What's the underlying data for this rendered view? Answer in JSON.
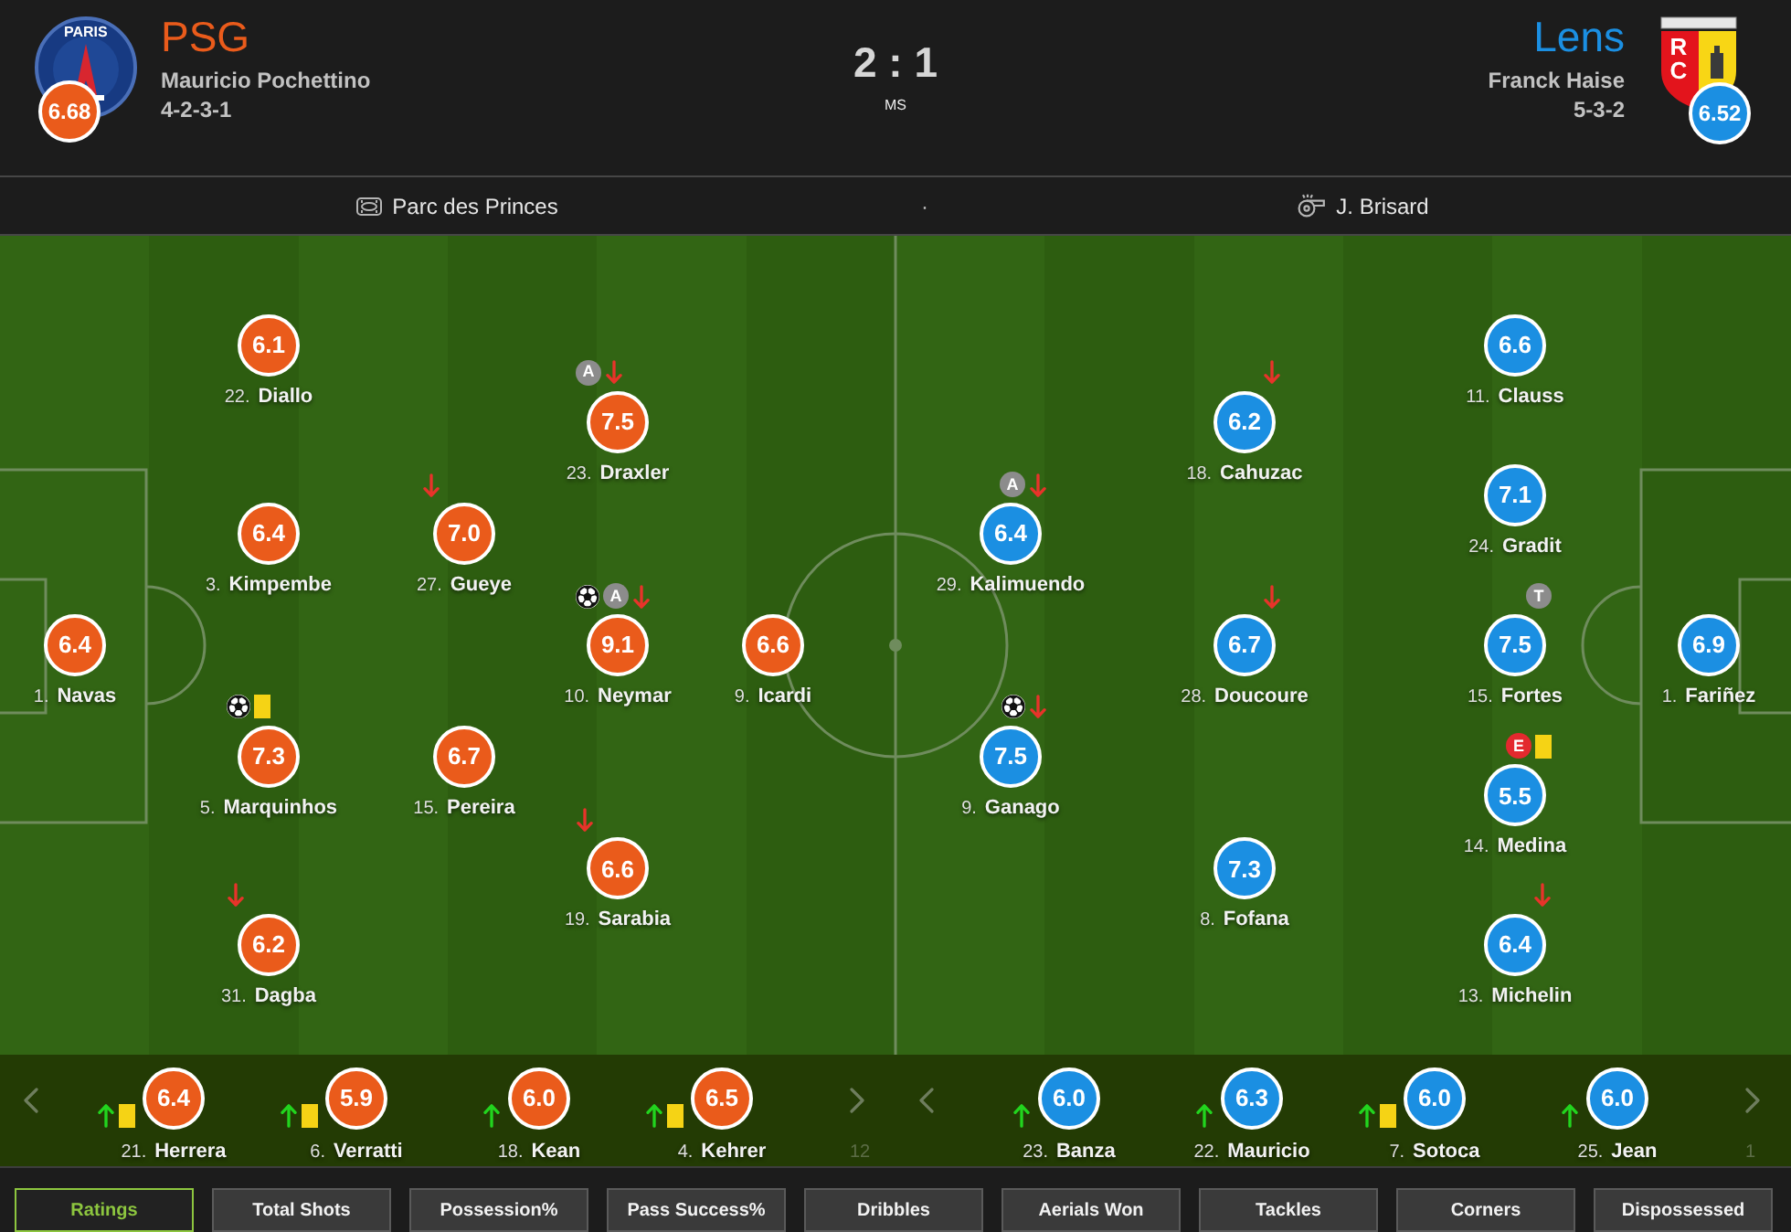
{
  "header": {
    "teams": [
      {
        "name": "PSG",
        "manager": "Mauricio Pochettino",
        "formation": "4-2-3-1",
        "rating": "6.68",
        "color": "#ea5b1b",
        "crest": {
          "kind": "roundel",
          "text": "PARIS"
        }
      },
      {
        "name": "Lens",
        "manager": "Franck Haise",
        "formation": "5-3-2",
        "rating": "6.52",
        "color": "#1b8fe2",
        "crest": {
          "kind": "shield",
          "text": "RC"
        }
      }
    ],
    "score": "2 : 1",
    "status": "MS"
  },
  "info_bar": {
    "venue": "Parc des Princes",
    "separator": "·",
    "referee": "J. Brisard"
  },
  "pitch": {
    "teams": [
      {
        "color": "#ea5b1b",
        "lines": [
          {
            "players": [
              {
                "number": "1.",
                "name": "Navas",
                "rating": "6.4"
              }
            ]
          },
          {
            "players": [
              {
                "number": "22.",
                "name": "Diallo",
                "rating": "6.1"
              },
              {
                "number": "3.",
                "name": "Kimpembe",
                "rating": "6.4"
              },
              {
                "number": "5.",
                "name": "Marquinhos",
                "rating": "7.3",
                "events": [
                  {
                    "kind": "goal"
                  },
                  {
                    "kind": "yellow_card"
                  }
                ]
              },
              {
                "number": "31.",
                "name": "Dagba",
                "rating": "6.2",
                "events": [
                  {
                    "kind": "subbed_off"
                  }
                ]
              }
            ]
          },
          {
            "players": [
              {
                "number": "27.",
                "name": "Gueye",
                "rating": "7.0",
                "events": [
                  {
                    "kind": "subbed_off"
                  }
                ]
              },
              {
                "number": "15.",
                "name": "Pereira",
                "rating": "6.7"
              }
            ]
          },
          {
            "players": [
              {
                "number": "23.",
                "name": "Draxler",
                "rating": "7.5",
                "events": [
                  {
                    "kind": "badge",
                    "text": "A",
                    "color": "#8c8c8c"
                  },
                  {
                    "kind": "subbed_off"
                  }
                ]
              },
              {
                "number": "10.",
                "name": "Neymar",
                "rating": "9.1",
                "events": [
                  {
                    "kind": "goal"
                  },
                  {
                    "kind": "badge",
                    "text": "A",
                    "color": "#8c8c8c"
                  },
                  {
                    "kind": "subbed_off"
                  }
                ]
              },
              {
                "number": "19.",
                "name": "Sarabia",
                "rating": "6.6",
                "events": [
                  {
                    "kind": "subbed_off"
                  }
                ]
              }
            ]
          },
          {
            "players": [
              {
                "number": "9.",
                "name": "Icardi",
                "rating": "6.6"
              }
            ]
          }
        ]
      },
      {
        "color": "#1b8fe2",
        "lines": [
          {
            "players": [
              {
                "number": "29.",
                "name": "Kalimuendo",
                "rating": "6.4",
                "events": [
                  {
                    "kind": "badge",
                    "text": "A",
                    "color": "#8c8c8c"
                  },
                  {
                    "kind": "subbed_off"
                  }
                ]
              },
              {
                "number": "9.",
                "name": "Ganago",
                "rating": "7.5",
                "events": [
                  {
                    "kind": "goal"
                  },
                  {
                    "kind": "subbed_off"
                  }
                ]
              }
            ]
          },
          {
            "players": [
              {
                "number": "18.",
                "name": "Cahuzac",
                "rating": "6.2",
                "events": [
                  {
                    "kind": "subbed_off"
                  }
                ]
              },
              {
                "number": "28.",
                "name": "Doucoure",
                "rating": "6.7",
                "events": [
                  {
                    "kind": "subbed_off"
                  }
                ]
              },
              {
                "number": "8.",
                "name": "Fofana",
                "rating": "7.3"
              }
            ]
          },
          {
            "players": [
              {
                "number": "11.",
                "name": "Clauss",
                "rating": "6.6"
              },
              {
                "number": "24.",
                "name": "Gradit",
                "rating": "7.1"
              },
              {
                "number": "15.",
                "name": "Fortes",
                "rating": "7.5",
                "events": [
                  {
                    "kind": "badge",
                    "text": "T",
                    "color": "#8c8c8c"
                  }
                ]
              },
              {
                "number": "14.",
                "name": "Medina",
                "rating": "5.5",
                "events": [
                  {
                    "kind": "badge",
                    "text": "E",
                    "color": "#e3292e"
                  },
                  {
                    "kind": "yellow_card"
                  }
                ]
              },
              {
                "number": "13.",
                "name": "Michelin",
                "rating": "6.4",
                "events": [
                  {
                    "kind": "subbed_off"
                  }
                ]
              }
            ]
          },
          {
            "players": [
              {
                "number": "1.",
                "name": "Fariñez",
                "rating": "6.9"
              }
            ]
          }
        ]
      }
    ]
  },
  "substitutes": [
    {
      "color": "#ea5b1b",
      "players": [
        {
          "number": "21.",
          "name": "Herrera",
          "rating": "6.4",
          "events": [
            {
              "kind": "subbed_on"
            },
            {
              "kind": "yellow_card"
            }
          ]
        },
        {
          "number": "6.",
          "name": "Verratti",
          "rating": "5.9",
          "events": [
            {
              "kind": "subbed_on"
            },
            {
              "kind": "yellow_card"
            }
          ]
        },
        {
          "number": "18.",
          "name": "Kean",
          "rating": "6.0",
          "events": [
            {
              "kind": "subbed_on"
            }
          ]
        },
        {
          "number": "4.",
          "name": "Kehrer",
          "rating": "6.5",
          "events": [
            {
              "kind": "subbed_on"
            },
            {
              "kind": "yellow_card"
            }
          ]
        }
      ],
      "peek": "12"
    },
    {
      "color": "#1b8fe2",
      "players": [
        {
          "number": "23.",
          "name": "Banza",
          "rating": "6.0",
          "events": [
            {
              "kind": "subbed_on"
            }
          ]
        },
        {
          "number": "22.",
          "name": "Mauricio",
          "rating": "6.3",
          "events": [
            {
              "kind": "subbed_on"
            }
          ]
        },
        {
          "number": "7.",
          "name": "Sotoca",
          "rating": "6.0",
          "events": [
            {
              "kind": "subbed_on"
            },
            {
              "kind": "yellow_card"
            }
          ]
        },
        {
          "number": "25.",
          "name": "Jean",
          "rating": "6.0",
          "events": [
            {
              "kind": "subbed_on"
            }
          ]
        }
      ],
      "peek": "1"
    }
  ],
  "tabs": [
    {
      "label": "Ratings",
      "selected": true
    },
    {
      "label": "Total Shots",
      "selected": false
    },
    {
      "label": "Possession%",
      "selected": false
    },
    {
      "label": "Pass Success%",
      "selected": false
    },
    {
      "label": "Dribbles",
      "selected": false
    },
    {
      "label": "Aerials Won",
      "selected": false
    },
    {
      "label": "Tackles",
      "selected": false
    },
    {
      "label": "Corners",
      "selected": false
    },
    {
      "label": "Dispossessed",
      "selected": false
    }
  ]
}
